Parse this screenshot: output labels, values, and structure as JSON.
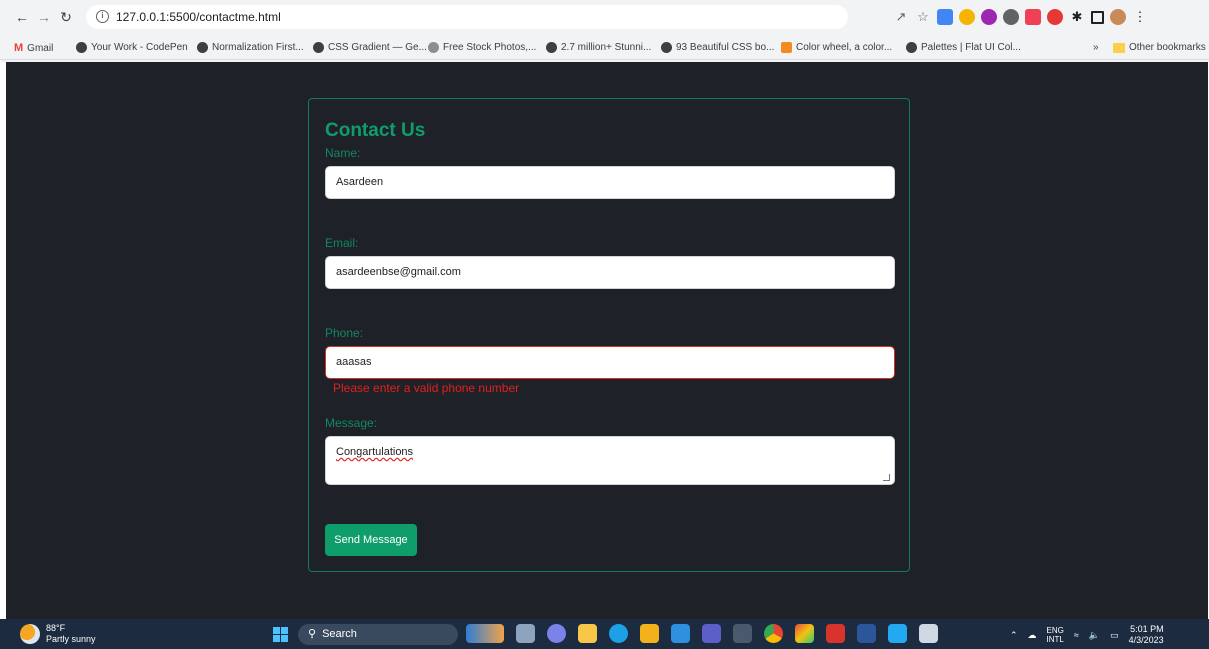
{
  "browser": {
    "url": "127.0.0.1:5500/contactme.html",
    "bookmarks": [
      "Gmail",
      "Your Work - CodePen",
      "Normalization First...",
      "CSS Gradient — Ge...",
      "Free Stock Photos,...",
      "2.7 million+ Stunni...",
      "93 Beautiful CSS bo...",
      "Color wheel, a color...",
      "Palettes | Flat UI Col..."
    ],
    "more_label": "»",
    "other_bookmarks": "Other bookmarks"
  },
  "form": {
    "title": "Contact Us",
    "name_label": "Name:",
    "name_value": "Asardeen",
    "email_label": "Email:",
    "email_value": "asardeenbse@gmail.com",
    "phone_label": "Phone:",
    "phone_value": "aaasas",
    "phone_error": "Please enter a valid phone number",
    "message_label": "Message:",
    "message_value": "Congartulations",
    "send_label": "Send Message"
  },
  "taskbar": {
    "temperature": "88°F",
    "weather": "Partly sunny",
    "search_label": "Search",
    "lang_top": "ENG",
    "lang_bottom": "INTL",
    "time": "5:01 PM",
    "date": "4/3/2023"
  },
  "colors": {
    "accent": "#0f9d6b",
    "page_bg": "#1e2127",
    "error": "#e0211e"
  }
}
